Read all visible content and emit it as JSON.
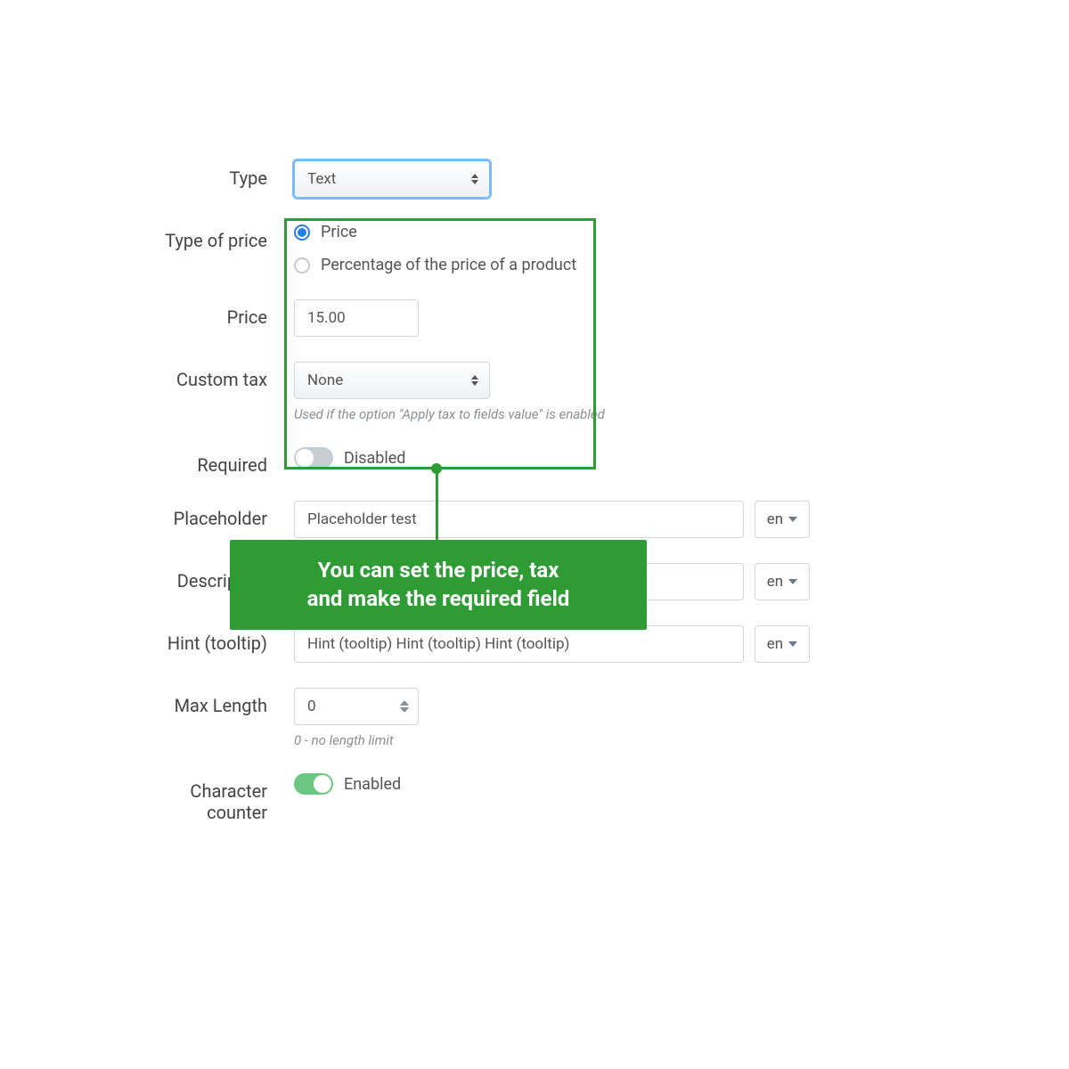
{
  "fields": {
    "type": {
      "label": "Type",
      "value": "Text"
    },
    "typeOfPrice": {
      "label": "Type of price",
      "options": [
        "Price",
        "Percentage of the price of a product"
      ],
      "selected": "Price"
    },
    "price": {
      "label": "Price",
      "value": "15.00"
    },
    "customTax": {
      "label": "Custom tax",
      "value": "None",
      "help": "Used if the option \"Apply tax to fields value\" is enabled"
    },
    "required": {
      "label": "Required",
      "state": "Disabled"
    },
    "placeholder": {
      "label": "Placeholder",
      "value": "Placeholder test",
      "lang": "en"
    },
    "description": {
      "label": "Description",
      "value": "",
      "lang": "en"
    },
    "hint": {
      "label": "Hint (tooltip)",
      "value": "Hint (tooltip) Hint (tooltip) Hint (tooltip)",
      "lang": "en"
    },
    "maxLength": {
      "label": "Max Length",
      "value": "0",
      "help": "0 - no length limit"
    },
    "charCounter": {
      "label": "Character counter",
      "state": "Enabled"
    }
  },
  "callout": {
    "line1": "You can set the price, tax",
    "line2": "and make the required field"
  }
}
